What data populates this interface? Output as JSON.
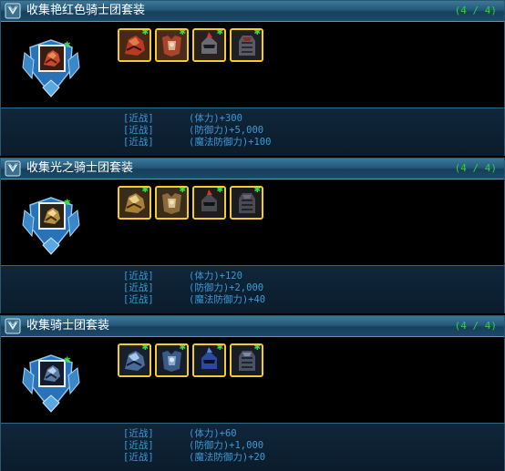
{
  "panels": [
    {
      "title": "收集艳红色骑士团套装",
      "count": "(4 / 4)",
      "theme": "red",
      "stats": [
        {
          "category": "[近战]",
          "name": "(体力)",
          "value": "+300"
        },
        {
          "category": "[近战]",
          "name": "(防御力)",
          "value": "+5,000"
        },
        {
          "category": "[近战]",
          "name": "(魔法防御力)",
          "value": "+100"
        }
      ]
    },
    {
      "title": "收集光之骑士团套装",
      "count": "(4 / 4)",
      "theme": "gold",
      "stats": [
        {
          "category": "[近战]",
          "name": "(体力)",
          "value": "+120"
        },
        {
          "category": "[近战]",
          "name": "(防御力)",
          "value": "+2,000"
        },
        {
          "category": "[近战]",
          "name": "(魔法防御力)",
          "value": "+40"
        }
      ]
    },
    {
      "title": "收集骑士团套装",
      "count": "(4 / 4)",
      "theme": "blue",
      "stats": [
        {
          "category": "[近战]",
          "name": "(体力)",
          "value": "+60"
        },
        {
          "category": "[近战]",
          "name": "(防御力)",
          "value": "+1,000"
        },
        {
          "category": "[近战]",
          "name": "(魔法防御力)",
          "value": "+20"
        }
      ]
    }
  ],
  "icons": {
    "header": "wing-emblem-icon",
    "emblem": "winged-crest-icon",
    "slot_items": [
      "dragon-armor-icon",
      "chest-armor-icon",
      "helmet-icon",
      "gauntlet-icon"
    ],
    "collected_marker": "green-star-icon"
  },
  "colors": {
    "title_text": "#ffffff",
    "count_text": "#2fd03a",
    "stat_text": "#3a9ad8",
    "slot_border": "#f2cc2a",
    "header_bg": "#24587a",
    "stats_bg": "#10263a"
  }
}
